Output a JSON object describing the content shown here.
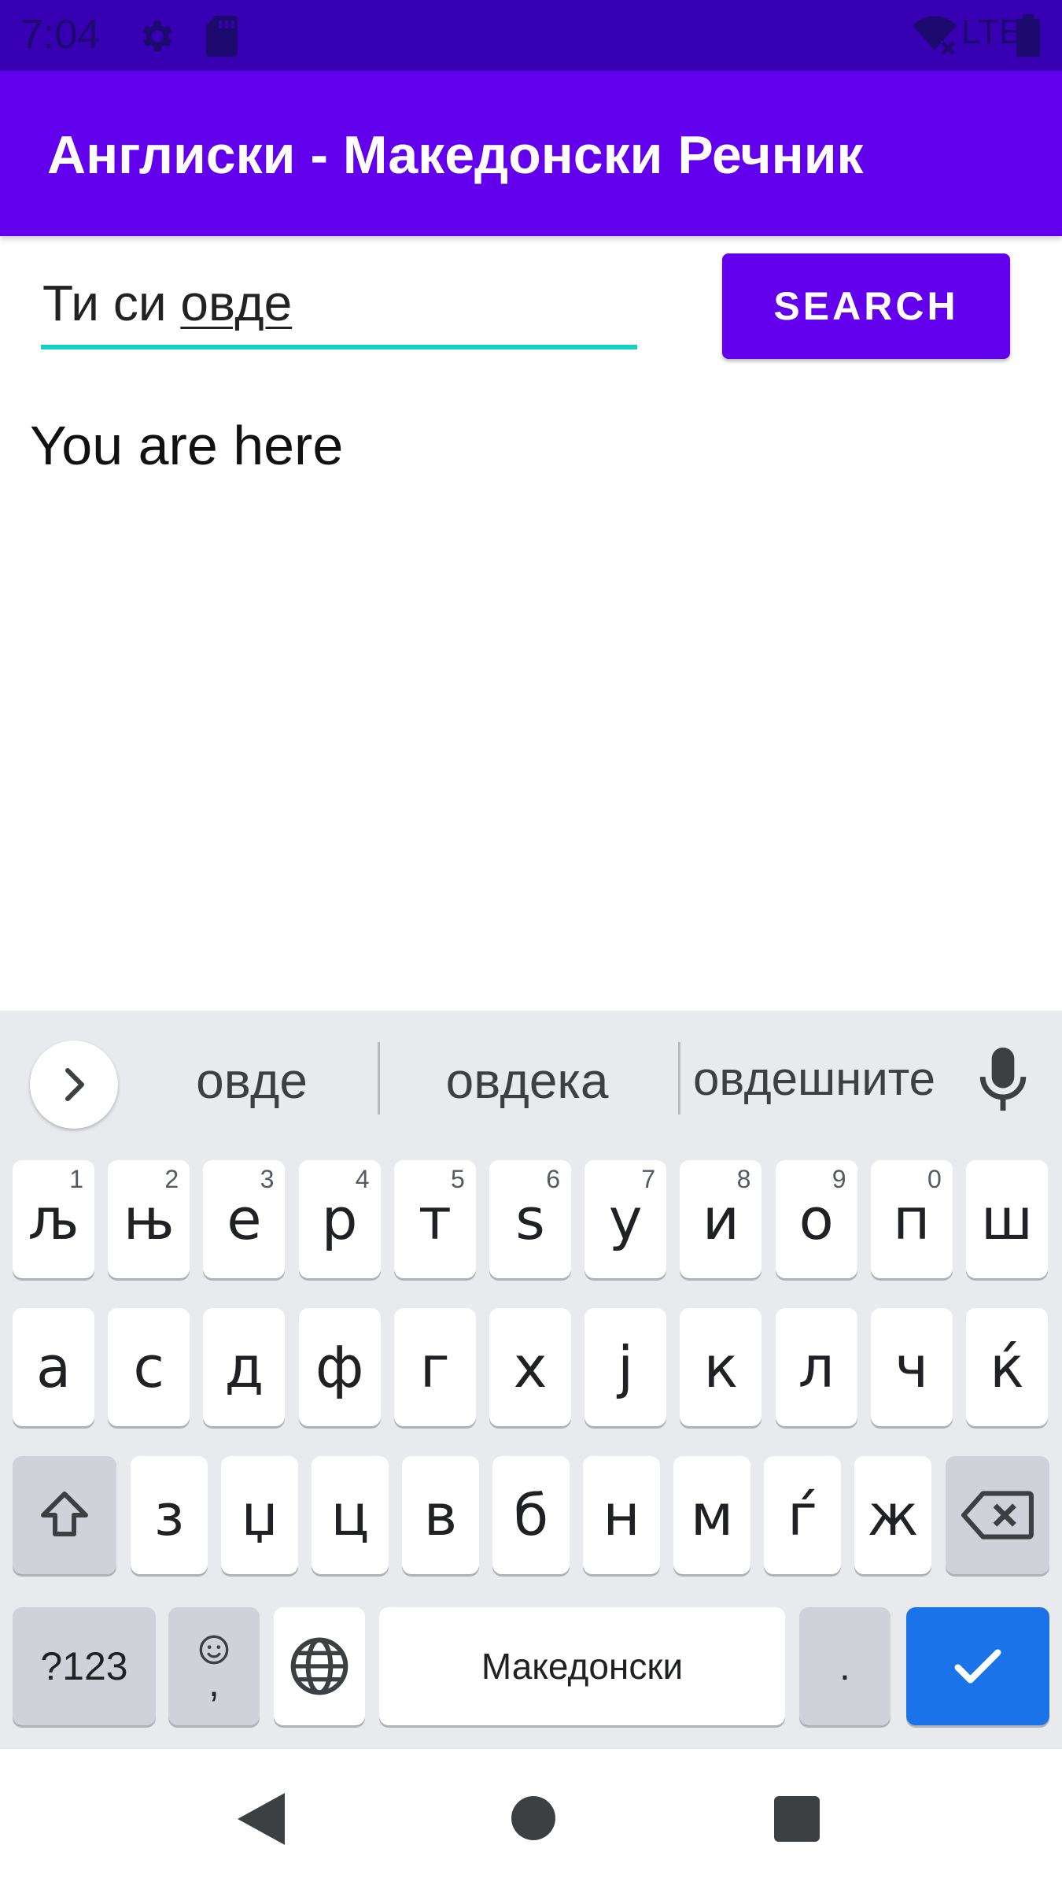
{
  "status_bar": {
    "time": "7:04",
    "icons": [
      "settings-icon",
      "sd-card-icon",
      "wifi-off-icon",
      "lte-icon",
      "battery-icon"
    ],
    "network_label": "LTE"
  },
  "app_bar": {
    "title": "Англиски - Македонски Речник",
    "color": "#6200EE"
  },
  "search": {
    "input_prefix": "Ти си ",
    "input_composing": "овде",
    "button_label": "SEARCH"
  },
  "result": {
    "text": "You are here"
  },
  "keyboard": {
    "suggestions": [
      "овде",
      "овдека",
      "овдешните"
    ],
    "row1": [
      {
        "char": "љ",
        "hint": "1"
      },
      {
        "char": "њ",
        "hint": "2"
      },
      {
        "char": "е",
        "hint": "3"
      },
      {
        "char": "р",
        "hint": "4"
      },
      {
        "char": "т",
        "hint": "5"
      },
      {
        "char": "ѕ",
        "hint": "6"
      },
      {
        "char": "у",
        "hint": "7"
      },
      {
        "char": "и",
        "hint": "8"
      },
      {
        "char": "о",
        "hint": "9"
      },
      {
        "char": "п",
        "hint": "0"
      },
      {
        "char": "ш",
        "hint": ""
      }
    ],
    "row2": [
      "а",
      "с",
      "д",
      "ф",
      "г",
      "х",
      "ј",
      "к",
      "л",
      "ч",
      "ќ"
    ],
    "row3": [
      "з",
      "џ",
      "ц",
      "в",
      "б",
      "н",
      "м",
      "ѓ",
      "ж"
    ],
    "symbols_label": "?123",
    "comma_label": ",",
    "space_label": "Македонски",
    "period_label": ".",
    "accent_color": "#1a73e8"
  },
  "nav_bar": {
    "icons": [
      "back-icon",
      "home-icon",
      "recents-icon"
    ]
  }
}
